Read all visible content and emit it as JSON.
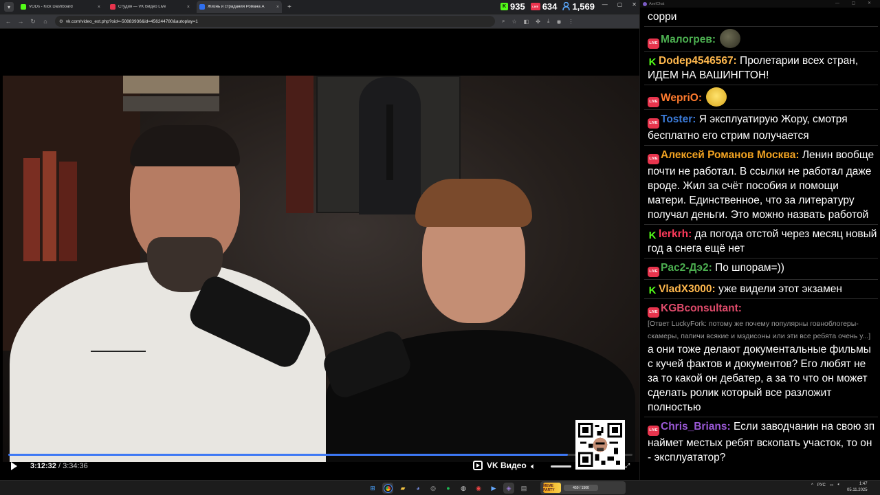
{
  "browser": {
    "tabs": [
      {
        "title": "VODs - Kick Dashboard",
        "favicon_color": "#53fc18",
        "active": false
      },
      {
        "title": "Студия — VK Видео Live",
        "favicon_color": "#e8344d",
        "active": false
      },
      {
        "title": "Жизнь и страдания Романа А",
        "favicon_color": "#2f6fef",
        "active": true
      }
    ],
    "new_tab": "+",
    "close_glyph": "×",
    "url": "vk.com/video_ext.php?oid=-50883936&id=456244780&autoplay=1"
  },
  "stats": {
    "kick": {
      "icon": "K",
      "value": "935",
      "color": "#53fc18"
    },
    "vk": {
      "icon": "LIVE",
      "value": "634",
      "color": "#e8344d"
    },
    "viewers": {
      "icon": "user-icon",
      "value": "1,569",
      "color": "#5aa9ff"
    }
  },
  "player": {
    "current_time": "3:12:32",
    "separator": " / ",
    "duration": "3:34:36",
    "progress_fraction": 0.897,
    "brand": "VK Видео",
    "accent": "#3d78f5"
  },
  "chat": {
    "window_title": "AxelChat",
    "messages": [
      {
        "platform": "none",
        "nick": "",
        "nick_color": "#ffffff",
        "text": "сорри"
      },
      {
        "platform": "vk",
        "nick": "Малогрев:",
        "nick_color": "#4caf50",
        "text": "",
        "emote": "frog-emote"
      },
      {
        "platform": "kick",
        "nick": "Dodep4546567:",
        "nick_color": "#ffb84d",
        "text": "Пролетарии всех стран, ИДЕМ НА ВАШИНГТОН!"
      },
      {
        "platform": "vk",
        "nick": "WepriO:",
        "nick_color": "#ff7b2e",
        "text": "",
        "emote": "smile-emote"
      },
      {
        "platform": "vk",
        "nick": "Toster:",
        "nick_color": "#3b7bd9",
        "text": "Я эксплуатирую Жору, смотря бесплатно его стрим получается"
      },
      {
        "platform": "vk",
        "nick": "Алексей Романов Москва:",
        "nick_color": "#f2a322",
        "text": "Ленин вообще почти не работал. В ссылки не работал даже вроде. Жил за счёт пособия и помощи матери. Единственное, что за литературу получал деньги. Это можно назвать работой"
      },
      {
        "platform": "kick",
        "nick": "lerkrh:",
        "nick_color": "#ff3b5c",
        "text": "да погода отстой через месяц новый год а снега ещё нет"
      },
      {
        "platform": "vk",
        "nick": "Pac2-Дэ2:",
        "nick_color": "#4caf50",
        "text": "По шпорам=))"
      },
      {
        "platform": "kick",
        "nick": "VladX3000:",
        "nick_color": "#ffb84d",
        "text": "уже видели этот экзамен"
      },
      {
        "platform": "vk",
        "nick": "KGBconsultant:",
        "nick_color": "#e04b6b",
        "reply": "[Ответ LuckyFork: потому же почему популярны говноблогеры-скамеры, папичи всякие и мэдисоны или эти все ребята очень у...]",
        "text": "а они тоже делают документальные фильмы с кучей фактов и документов? Его любят не за то какой он дебатер, а за то что он может сделать ролик который все разложит полностью"
      },
      {
        "platform": "vk",
        "nick": "Chris_Brians:",
        "nick_color": "#9b59d6",
        "text": "Если заводчанин на свою зп наймет местых ребят вскопать участок, то он - эксплуататор?"
      }
    ]
  },
  "taskbar": {
    "meme_party": "MEME PARTY",
    "meme_progress": "450 / 1500",
    "lang": "РУС",
    "time": "1:47",
    "date": "05.11.2025"
  }
}
